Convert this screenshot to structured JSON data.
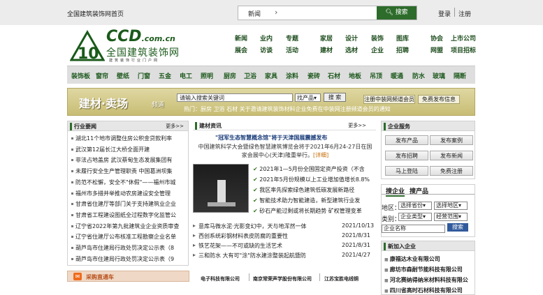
{
  "topbar": {
    "home": "全国建筑装饰网首页",
    "search_select": "新闻",
    "search_button": "搜索",
    "login": "登录",
    "register": "注册"
  },
  "logo": {
    "ccd": "CCD",
    "domain": ".com.cn",
    "name": "全国建筑装饰网",
    "sub": "建筑装饰行业门户网"
  },
  "nav": {
    "col1": [
      "新闻",
      "展会"
    ],
    "col2": [
      "业内",
      "访谈"
    ],
    "col3": [
      "专题",
      "活动"
    ],
    "col4": [
      "家居",
      "建材"
    ],
    "col5": [
      "设计",
      "选材"
    ],
    "col6": [
      "装饰",
      "企业"
    ],
    "col7": [
      "图库",
      "招聘"
    ],
    "col8": [
      "协会",
      "网盟"
    ],
    "col9": [
      "上市公司",
      "项目招标"
    ]
  },
  "categories": [
    "装饰板",
    "窗帘",
    "壁纸",
    "门窗",
    "五金",
    "电工",
    "照明",
    "厨房",
    "卫浴",
    "家具",
    "涂料",
    "瓷砖",
    "石材",
    "地板",
    "吊顶",
    "暖通",
    "防水",
    "玻璃",
    "隔断"
  ],
  "banner": {
    "title": "建材·卖场",
    "subtitle": "频道",
    "search_placeholder": "请输入搜索关键词",
    "search_select": "找产品",
    "search_button": "搜 索",
    "register_button": "注册中装网频道会员",
    "publish_button": "免费发布信息",
    "hot_label": "热门：",
    "hot_words": "厨房  卫浴  石材  关于邀请建筑装饰材料企业免费在中装网注册频道会员的通知"
  },
  "industry": {
    "title": "行业要闻",
    "more": "更多>>",
    "items": [
      "湖北11个地市调整住房公积金贷款利率",
      "武汉第12届长江大桥全面开建",
      "非法占地盖房 武汉蔡甸生态发展集团有",
      "未履行安全生产管理职责 中国葛洲坝集",
      "防范不松懈，安全不\"休假\"——福州市城",
      "福州市多措并举推动农房建设安全管理",
      "甘肃省住建厅等部门关于支持建筑业企业",
      "甘肃省工程建设图纸全过程数字化监管公",
      "辽宁省2022年第九批建筑业企业资质审查",
      "辽宁省住建厅公布核准工程勘察企业名单",
      "葫芦岛市住建局行政处罚决定公示表（8",
      "葫芦岛市住建局行政处罚决定公示表（9"
    ]
  },
  "materials": {
    "title": "建材资讯",
    "more": "更多>>",
    "headline": "\"冠军生态智慧概念馆\"将于天津国展震撼发布",
    "summary": "中国建筑科学大会暨绿色智慧建筑博览会将于2021年6月24-27日在国家会展中心(天津)隆重举行。",
    "detail": "[详细]",
    "bullets": [
      "2021年1—5月份全国固定资产投资（不含",
      "2021年5月份规模以上工业增加值增长8.8%",
      "我区率先探索绿色建筑低碳发展新路径",
      "智能技术助力智能建造，新型建筑行业发",
      "砂石产能过剩或将长期趋势 矿权管理变革"
    ],
    "news": [
      {
        "title": "意库马微水泥·光影变幻中，天与地浑然一体",
        "date": "2021/10/13"
      },
      {
        "title": "西创系统彩钢材料表皮防腐的重要性",
        "date": "2021/8/31"
      },
      {
        "title": "铁艺花架——不可或缺的生活艺术",
        "date": "2021/8/31"
      },
      {
        "title": "三和防水 大有可\"涂\"防水建涂整装起航暨防",
        "date": "2021/4/27"
      }
    ]
  },
  "service": {
    "title": "企业服务",
    "buttons": [
      "发布产品",
      "发布案例",
      "发布招聘",
      "发布新闻",
      "马上登陆",
      "免费注册"
    ]
  },
  "search_co": {
    "tab1": "搜企业",
    "tab2": "搜产品",
    "region_label": "地区：",
    "province": "选择省份",
    "city": "选择地区",
    "category_label": "类别：",
    "company_type": "企业类型",
    "business_type": "经营范围",
    "name_placeholder": "企业名称",
    "button": "搜索"
  },
  "newco": {
    "title": "新加入企业",
    "items": [
      "康福达木业有限公司",
      "廊坊市森耐节能科技有限公司",
      "河北赛纳得纳米材料科技有限公",
      "四川省高时石材科技有限公司"
    ]
  },
  "purchase": {
    "title": "采购直通车",
    "companies": [
      "电子科技有限公司",
      "南京常荣声学股份有限公司",
      "江苏宝胜电线铜"
    ]
  }
}
